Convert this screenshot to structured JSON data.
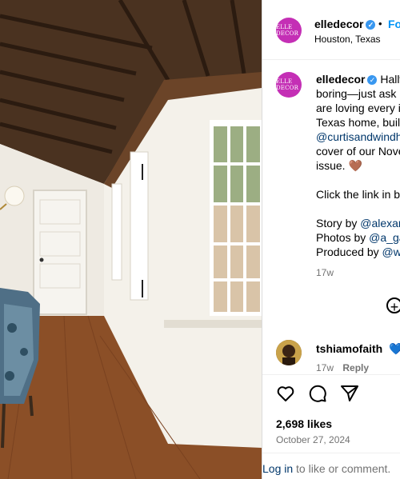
{
  "post": {
    "author": "elledecor",
    "avatar_text": "ELLE DECOR",
    "follow_label": "Follow",
    "separator": "•",
    "location": "Houston, Texas",
    "caption_lines": [
      "elledecor",
      "Hallway",
      "boring—just ask",
      "are loving every i",
      "Texas home, built",
      "@curtisandwindh",
      "cover of our Nove",
      "issue. 🤎",
      "Click the link in b",
      "Story by ",
      "@alexan",
      "Photos by ",
      "@a_ga",
      "Produced by ",
      "@w"
    ],
    "caption_time": "17w"
  },
  "comment": {
    "user": "tshiamofaith",
    "heart": "💙",
    "time": "17w",
    "reply_label": "Reply"
  },
  "actions": {
    "likes": "2,698 likes",
    "date": "October 27, 2024"
  },
  "login": {
    "link": "Log in",
    "rest": " to like or comment."
  },
  "colors": {
    "accent": "#0095f6",
    "avatar": "#c42fb5",
    "verified": "#3897f0"
  }
}
